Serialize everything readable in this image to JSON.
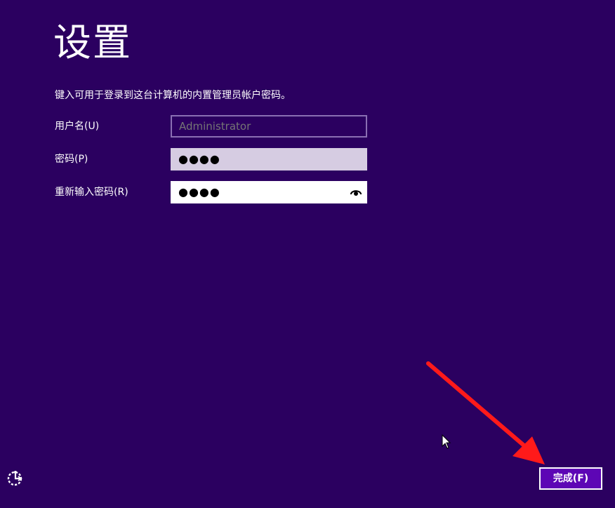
{
  "page": {
    "title": "设置",
    "instruction": "键入可用于登录到这台计算机的内置管理员帐户密码。"
  },
  "form": {
    "username": {
      "label": "用户名(U)",
      "placeholder": "Administrator",
      "value": ""
    },
    "password": {
      "label": "密码(P)",
      "masked_value": "●●●●"
    },
    "confirm_password": {
      "label": "重新输入密码(R)",
      "masked_value": "●●●●"
    }
  },
  "footer": {
    "finish_label": "完成(F)"
  },
  "icons": {
    "reveal_password": "eye-icon",
    "ease_of_access": "ease-of-access-icon"
  },
  "colors": {
    "background": "#2b0060",
    "accent_button": "#5d06b5",
    "annotation_arrow": "#ff1a1a"
  }
}
